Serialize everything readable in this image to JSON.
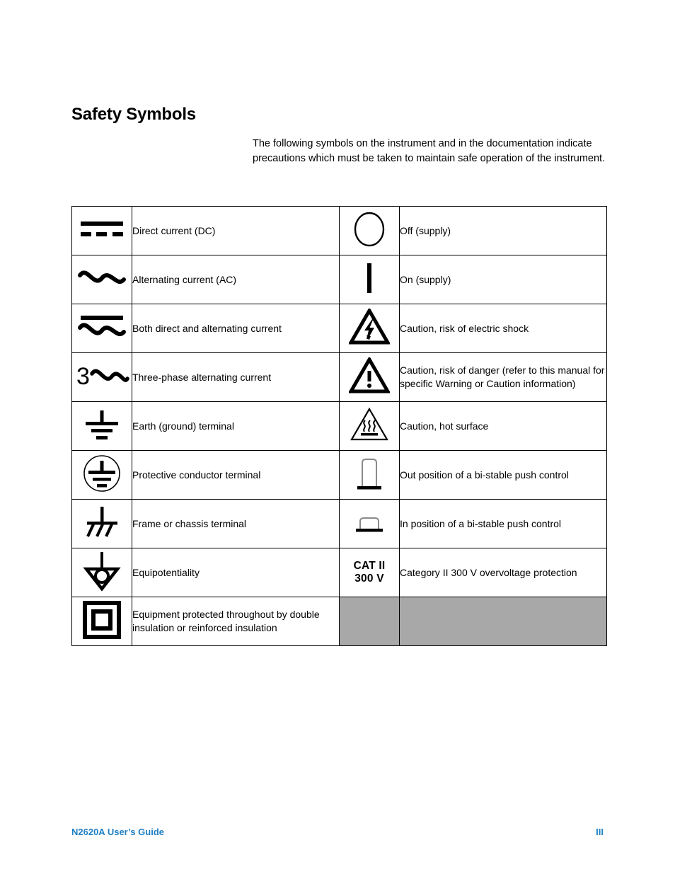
{
  "page": {
    "title": "Safety Symbols",
    "intro": "The following symbols on the instrument and in the documentation indicate precautions which must be taken to maintain safe operation of the instrument."
  },
  "colors": {
    "footer_accent": "#1f7fc4",
    "disabled_cell": "#a8a8a8",
    "rule": "#000000"
  },
  "table": {
    "rows": [
      {
        "left": {
          "icon": "direct-current-icon",
          "label": "Direct current (DC)"
        },
        "right": {
          "icon": "power-off-circle-icon",
          "label": "Off (supply)"
        }
      },
      {
        "left": {
          "icon": "alternating-current-icon",
          "label": "Alternating current (AC)"
        },
        "right": {
          "icon": "power-on-bar-icon",
          "label": "On (supply)"
        }
      },
      {
        "left": {
          "icon": "direct-and-alternating-current-icon",
          "label": "Both direct and alternating current"
        },
        "right": {
          "icon": "electric-shock-warning-icon",
          "label": "Caution, risk of electric shock"
        }
      },
      {
        "left": {
          "icon": "three-phase-alternating-current-icon",
          "label": "Three-phase alternating current"
        },
        "right": {
          "icon": "general-warning-icon",
          "label": "Caution, risk of danger (refer to this manual for specific Warning or Caution information)"
        }
      },
      {
        "left": {
          "icon": "earth-ground-icon",
          "label": "Earth (ground) terminal"
        },
        "right": {
          "icon": "hot-surface-warning-icon",
          "label": "Caution, hot surface"
        }
      },
      {
        "left": {
          "icon": "protective-conductor-icon",
          "label": "Protective conductor terminal"
        },
        "right": {
          "icon": "push-control-out-icon",
          "label": "Out position of a bi-stable push control"
        }
      },
      {
        "left": {
          "icon": "frame-chassis-icon",
          "label": "Frame or chassis terminal"
        },
        "right": {
          "icon": "push-control-in-icon",
          "label": "In position of a bi-stable push control"
        }
      },
      {
        "left": {
          "icon": "equipotentiality-icon",
          "label": "Equipotentiality"
        },
        "right": {
          "icon": "cat-rating-text",
          "label": "Category II 300 V overvoltage protection",
          "text_line1": "CAT II",
          "text_line2": "300 V"
        }
      },
      {
        "left": {
          "icon": "double-insulation-icon",
          "label": "Equipment protected throughout by double insulation or reinforced insulation"
        },
        "right": {
          "icon": "",
          "label": ""
        }
      }
    ]
  },
  "footer": {
    "document": "N2620A User’s Guide",
    "page_number": "III"
  }
}
